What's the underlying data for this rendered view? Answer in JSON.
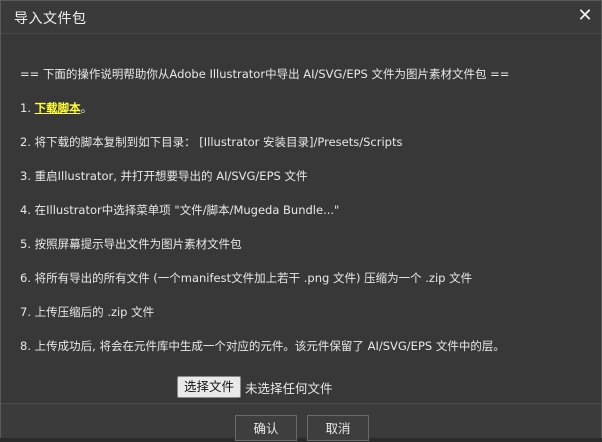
{
  "dialog": {
    "title": "导入文件包",
    "close_glyph": "✕",
    "close_icon": "close-icon"
  },
  "instructions": {
    "heading": "== 下面的操作说明帮助你从Adobe Illustrator中导出 AI/SVG/EPS 文件为图片素材文件包 ==",
    "step1_prefix": "1. ",
    "step1_link": "下载脚本",
    "step1_suffix": "。",
    "step2": "2. 将下载的脚本复制到如下目录： [Illustrator 安装目录]/Presets/Scripts",
    "step3": "3. 重启Illustrator, 并打开想要导出的 AI/SVG/EPS 文件",
    "step4": "4. 在Illustrator中选择菜单项 \"文件/脚本/Mugeda Bundle...\"",
    "step5": "5. 按照屏幕提示导出文件为图片素材文件包",
    "step6": "6. 将所有导出的所有文件 (一个manifest文件加上若干 .png 文件) 压缩为一个 .zip 文件",
    "step7": "7. 上传压缩后的 .zip 文件",
    "step8": "8. 上传成功后, 将会在元件库中生成一个对应的元件。该元件保留了 AI/SVG/EPS 文件中的层。"
  },
  "file_input": {
    "button_label": "选择文件",
    "status": "未选择任何文件"
  },
  "footer": {
    "ok_label": "确认",
    "cancel_label": "取消"
  },
  "colors": {
    "link": "#ffff33",
    "background": "#383838"
  }
}
